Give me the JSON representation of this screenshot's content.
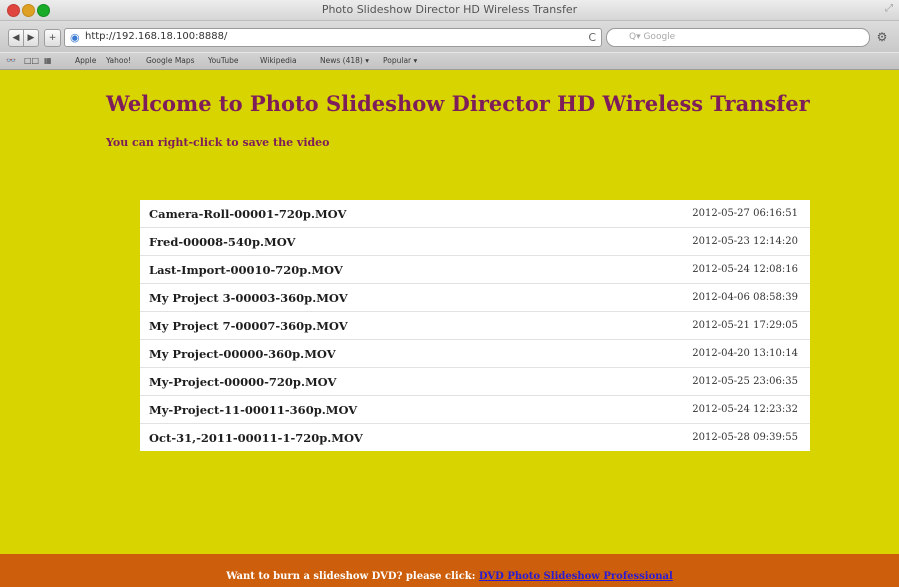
{
  "window": {
    "title": "Photo Slideshow Director HD Wireless Transfer"
  },
  "toolbar": {
    "back_icon": "back-arrow-icon",
    "back_glyph": "◀",
    "forward_icon": "forward-arrow-icon",
    "forward_glyph": "▶",
    "add_glyph": "+",
    "url": "http://192.168.18.100:8888/",
    "reload_glyph": "C",
    "search_placeholder": "Q▾ Google",
    "gear_glyph": "⚙"
  },
  "bookmarks": [
    "Apple",
    "Yahoo!",
    "Google Maps",
    "YouTube",
    "Wikipedia",
    "News (418) ▾",
    "Popular ▾"
  ],
  "page": {
    "heading": "Welcome to Photo Slideshow Director HD Wireless Transfer",
    "subheading": "You can right-click to save the video",
    "files": [
      {
        "name": "Camera-Roll-00001-720p.MOV",
        "date": "2012-05-27 06:16:51"
      },
      {
        "name": "Fred-00008-540p.MOV",
        "date": "2012-05-23 12:14:20"
      },
      {
        "name": "Last-Import-00010-720p.MOV",
        "date": "2012-05-24 12:08:16"
      },
      {
        "name": "My Project 3-00003-360p.MOV",
        "date": "2012-04-06 08:58:39"
      },
      {
        "name": "My Project 7-00007-360p.MOV",
        "date": "2012-05-21 17:29:05"
      },
      {
        "name": "My Project-00000-360p.MOV",
        "date": "2012-04-20 13:10:14"
      },
      {
        "name": "My-Project-00000-720p.MOV",
        "date": "2012-05-25 23:06:35"
      },
      {
        "name": "My-Project-11-00011-360p.MOV",
        "date": "2012-05-24 12:23:32"
      },
      {
        "name": "Oct-31,-2011-00011-1-720p.MOV",
        "date": "2012-05-28 09:39:55"
      }
    ],
    "footer_text": "Want to burn a slideshow DVD? please click: ",
    "footer_link": "DVD Photo Slideshow Professional"
  },
  "colors": {
    "page_bg": "#d8d400",
    "heading": "#7d1e5b",
    "footer_bg": "#cd5e0b",
    "link": "#2b1bd2"
  }
}
